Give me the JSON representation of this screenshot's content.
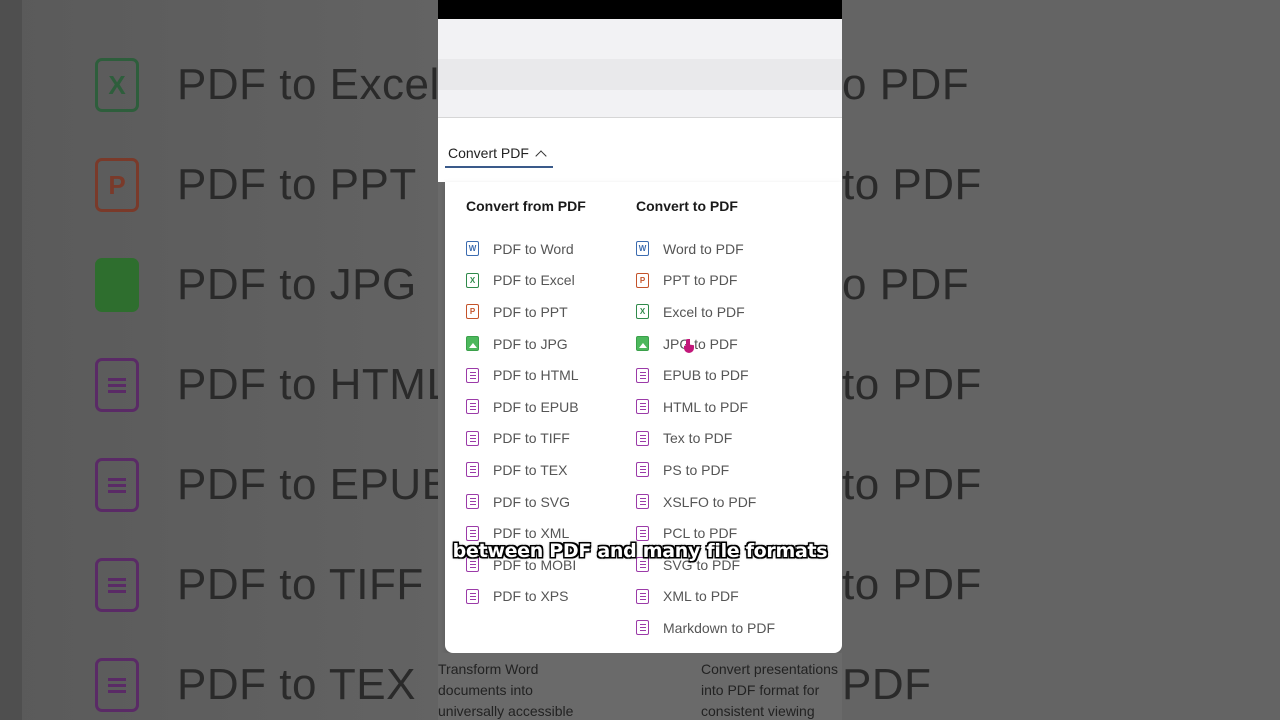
{
  "background": {
    "left_rows": [
      {
        "icon": "excel-icon",
        "text": "PDF to Excel"
      },
      {
        "icon": "ppt-icon",
        "text": "PDF to PPT"
      },
      {
        "icon": "image-icon",
        "text": "PDF to JPG"
      },
      {
        "icon": "document-icon",
        "text": "PDF to HTML"
      },
      {
        "icon": "document-icon",
        "text": "PDF to EPUB"
      },
      {
        "icon": "document-icon",
        "text": "PDF to TIFF"
      },
      {
        "icon": "document-icon",
        "text": "PDF to TEX"
      }
    ],
    "right_rows": [
      "o PDF",
      "to PDF",
      "o PDF",
      "to PDF",
      "to PDF",
      "to PDF",
      "PDF"
    ]
  },
  "nav": {
    "menu_label": "Convert PDF"
  },
  "dropdown": {
    "from_title": "Convert from PDF",
    "to_title": "Convert to PDF",
    "from_items": [
      {
        "icon": "word",
        "label": "PDF to Word"
      },
      {
        "icon": "excel",
        "label": "PDF to Excel"
      },
      {
        "icon": "ppt",
        "label": "PDF to PPT"
      },
      {
        "icon": "image",
        "label": "PDF to JPG"
      },
      {
        "icon": "doc",
        "label": "PDF to HTML"
      },
      {
        "icon": "doc",
        "label": "PDF to EPUB"
      },
      {
        "icon": "doc",
        "label": "PDF to TIFF"
      },
      {
        "icon": "doc",
        "label": "PDF to TEX"
      },
      {
        "icon": "doc",
        "label": "PDF to SVG"
      },
      {
        "icon": "doc",
        "label": "PDF to XML"
      },
      {
        "icon": "doc",
        "label": "PDF to MOBI"
      },
      {
        "icon": "doc",
        "label": "PDF to XPS"
      }
    ],
    "to_items": [
      {
        "icon": "word",
        "label": "Word to PDF"
      },
      {
        "icon": "ppt",
        "label": "PPT to PDF"
      },
      {
        "icon": "excel",
        "label": "Excel to PDF"
      },
      {
        "icon": "image",
        "label": "JPG to PDF"
      },
      {
        "icon": "doc",
        "label": "EPUB to PDF"
      },
      {
        "icon": "doc",
        "label": "HTML to PDF"
      },
      {
        "icon": "doc",
        "label": "Tex to PDF"
      },
      {
        "icon": "doc",
        "label": "PS to PDF"
      },
      {
        "icon": "doc",
        "label": "XSLFO to PDF"
      },
      {
        "icon": "doc",
        "label": "PCL to PDF"
      },
      {
        "icon": "doc",
        "label": "SVG to PDF"
      },
      {
        "icon": "doc",
        "label": "XML to PDF"
      },
      {
        "icon": "doc",
        "label": "Markdown to PDF"
      }
    ]
  },
  "cards": {
    "left_text": "Transform Word documents into universally accessible",
    "right_text": "Convert presentations into PDF format for consistent viewing"
  },
  "caption": "between PDF and many file formats",
  "colors": {
    "accent_underline": "#3a5a8a",
    "word": "#3b6bb0",
    "excel": "#2f8a4a",
    "ppt": "#c4532a",
    "image": "#4cb85c",
    "doc": "#9b3aa8"
  }
}
